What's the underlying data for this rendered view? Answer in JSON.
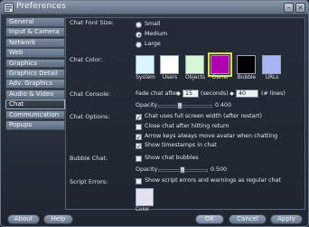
{
  "window": {
    "title": "Preferences"
  },
  "sidebar": {
    "tabs": [
      {
        "label": "General"
      },
      {
        "label": "Input & Camera"
      },
      {
        "label": "Network"
      },
      {
        "label": "Web"
      },
      {
        "label": "Graphics"
      },
      {
        "label": "Graphics Detail"
      },
      {
        "label": "Adv. Graphics"
      },
      {
        "label": "Audio & Video"
      },
      {
        "label": "Chat",
        "active": true
      },
      {
        "label": "Communication"
      },
      {
        "label": "Popups"
      }
    ]
  },
  "chat_font_size": {
    "label": "Chat Font Size:",
    "options": [
      "Small",
      "Medium",
      "Large"
    ],
    "selected": "Medium"
  },
  "chat_color": {
    "label": "Chat Color:",
    "swatches": [
      {
        "name": "System",
        "color": "#d9f7fb"
      },
      {
        "name": "Users",
        "color": "#ffffff"
      },
      {
        "name": "Objects",
        "color": "#d4f6d4"
      },
      {
        "name": "Owner",
        "color": "#b000b0",
        "selected": true
      },
      {
        "name": "Bubble",
        "color": "#000000"
      },
      {
        "name": "URLs",
        "color": "#a9b2f3"
      }
    ]
  },
  "chat_console": {
    "label": "Chat Console:",
    "fade_label": "Fade chat after",
    "fade_value": "15",
    "fade_unit": "(seconds)",
    "lines_value": "40",
    "lines_unit": "(# lines)",
    "opacity_label": "Opacity",
    "opacity_value": "0.400",
    "opacity_level": 0.4
  },
  "chat_options": {
    "label": "Chat Options:",
    "items": [
      {
        "label": "Chat uses full screen width (after restart)",
        "checked": true
      },
      {
        "label": "Close chat after hitting return",
        "checked": false
      },
      {
        "label": "Arrow keys always move avatar when chatting",
        "checked": true
      },
      {
        "label": "Show timestamps in chat",
        "checked": true
      }
    ]
  },
  "bubble_chat": {
    "label": "Bubble Chat:",
    "checkbox_label": "Show chat bubbles",
    "checked": false,
    "opacity_label": "Opacity",
    "opacity_value": "0.500",
    "opacity_level": 0.5
  },
  "script_errors": {
    "label": "Script Errors:",
    "checkbox_label": "Show script errors and warnings as regular chat",
    "checked": false,
    "color_label": "Color"
  },
  "buttons": {
    "about": "About",
    "help": "Help",
    "ok": "OK",
    "cancel": "Cancel",
    "apply": "Apply"
  }
}
